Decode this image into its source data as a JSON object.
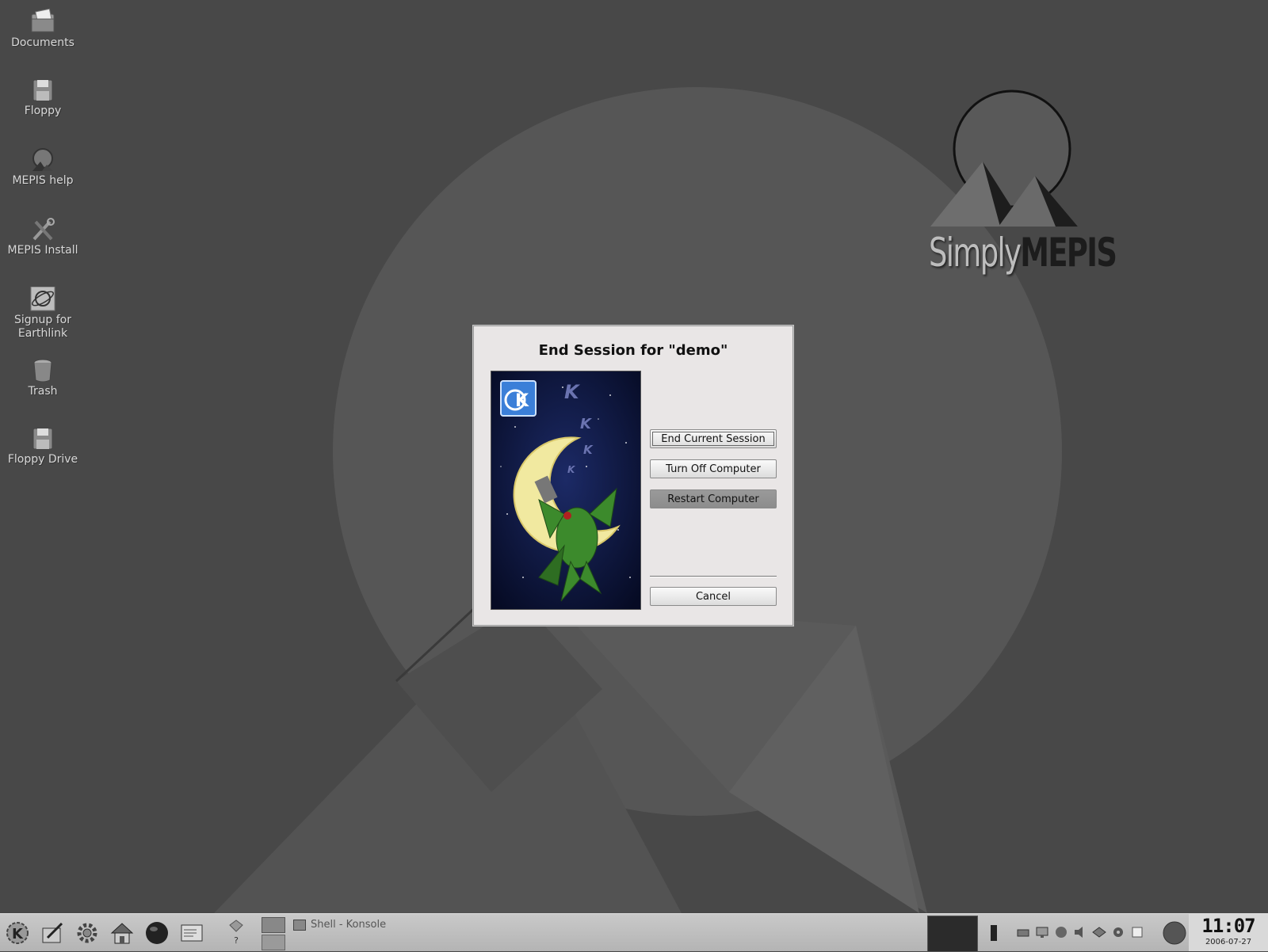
{
  "desktop": {
    "icons": [
      {
        "label": "Documents",
        "icon": "documents-folder-icon"
      },
      {
        "label": "Floppy",
        "icon": "floppy-icon"
      },
      {
        "label": "MEPIS help",
        "icon": "help-icon"
      },
      {
        "label": "MEPIS Install",
        "icon": "install-tools-icon"
      },
      {
        "label": "Signup for Earthlink",
        "icon": "earthlink-icon"
      },
      {
        "label": "Trash",
        "icon": "trash-icon"
      },
      {
        "label": "Floppy Drive",
        "icon": "floppy-drive-icon"
      }
    ],
    "wallpaper_logo": {
      "simply": "Simply",
      "mepis": "MEPIS"
    }
  },
  "dialog": {
    "title": "End Session for \"demo\"",
    "buttons": {
      "end_session": "End Current Session",
      "turn_off": "Turn Off Computer",
      "restart": "Restart Computer",
      "cancel": "Cancel"
    }
  },
  "taskbar": {
    "task_label": "Shell - Konsole",
    "help_label": "?",
    "clock_time": "11:07",
    "clock_date": "2006-07-27"
  },
  "colors": {
    "desktop_bg": "#484848",
    "dialog_bg": "#e9e6e6",
    "taskbar_bg": "#bdbdbd"
  }
}
